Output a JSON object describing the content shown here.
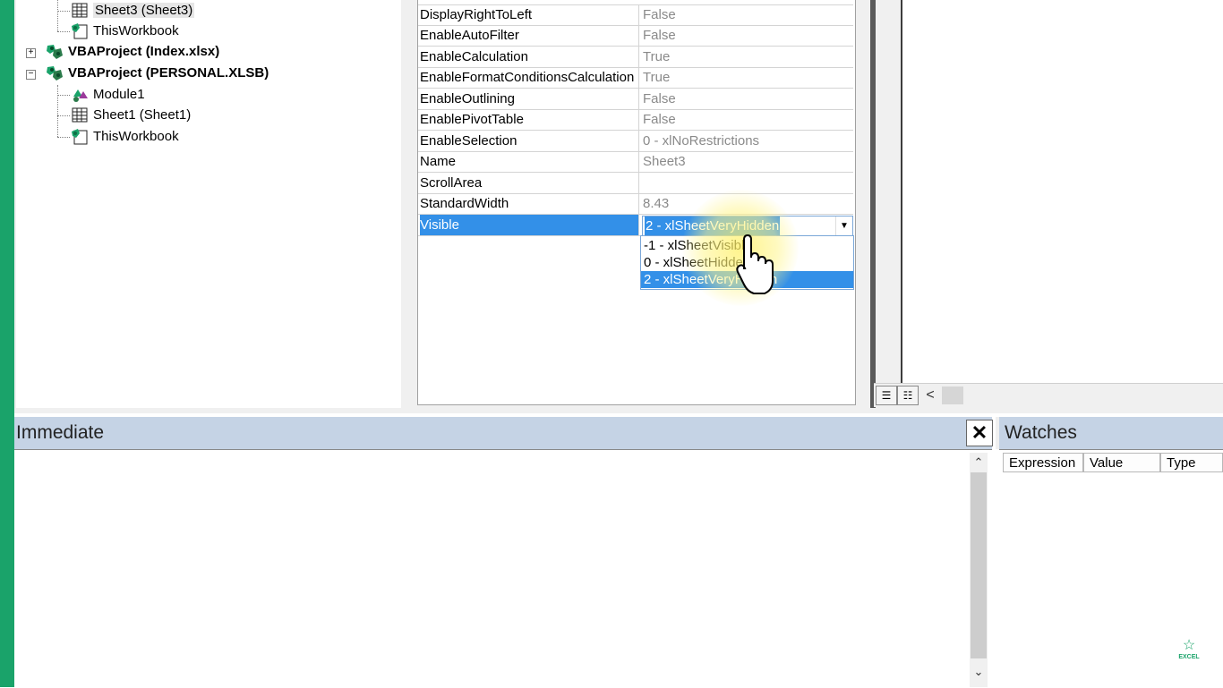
{
  "project_tree": {
    "items": [
      {
        "label": "Sheet3 (Sheet3)",
        "icon": "sheet-icon",
        "bold": false,
        "selected": true
      },
      {
        "label": "ThisWorkbook",
        "icon": "workbook-icon",
        "bold": false
      },
      {
        "label": "VBAProject (Index.xlsx)",
        "icon": "vbaproject-icon",
        "bold": true,
        "expander": "+"
      },
      {
        "label": "VBAProject (PERSONAL.XLSB)",
        "icon": "vbaproject-icon",
        "bold": true,
        "expander": "−"
      },
      {
        "label": "Module1",
        "icon": "module-icon",
        "bold": false
      },
      {
        "label": "Sheet1 (Sheet1)",
        "icon": "sheet-icon",
        "bold": false
      },
      {
        "label": "ThisWorkbook",
        "icon": "workbook-icon",
        "bold": false
      }
    ]
  },
  "properties": {
    "rows": [
      {
        "name": "DisplayRightToLeft",
        "value": "False"
      },
      {
        "name": "EnableAutoFilter",
        "value": "False"
      },
      {
        "name": "EnableCalculation",
        "value": "True"
      },
      {
        "name": "EnableFormatConditionsCalculation",
        "value": "True"
      },
      {
        "name": "EnableOutlining",
        "value": "False"
      },
      {
        "name": "EnablePivotTable",
        "value": "False"
      },
      {
        "name": "EnableSelection",
        "value": "0 - xlNoRestrictions"
      },
      {
        "name": "Name",
        "value": "Sheet3"
      },
      {
        "name": "ScrollArea",
        "value": ""
      },
      {
        "name": "StandardWidth",
        "value": "8.43"
      },
      {
        "name": "Visible",
        "value": "2 - xlSheetVeryHidden"
      }
    ],
    "dropdown": {
      "current": "2 - xlSheetVeryHidden",
      "options": [
        "-1 - xlSheetVisible",
        "0 - xlSheetHidden",
        "2 - xlSheetVeryHidden"
      ]
    }
  },
  "code_toolbar": {
    "procedure_view_icon": "procedure-view-icon",
    "full_module_view_icon": "full-module-view-icon",
    "scroll_left": "<"
  },
  "immediate": {
    "title": "Immediate",
    "close": "✕",
    "scroll_up": "⌃",
    "scroll_down": "⌄"
  },
  "watches": {
    "title": "Watches",
    "columns": [
      "Expression",
      "Value",
      "Type"
    ]
  },
  "logo": {
    "text": "EXCEL"
  },
  "colors": {
    "accent": "#1aa36a",
    "selection": "#3390e8",
    "titlebar": "#c5d3e5"
  }
}
